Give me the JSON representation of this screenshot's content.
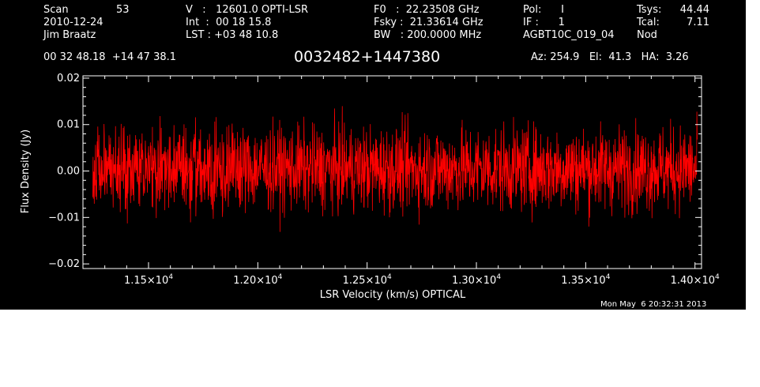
{
  "header": {
    "col1": {
      "l1_label": "Scan",
      "l1_value": "53",
      "l2": "2010-12-24",
      "l3": "Jim Braatz"
    },
    "col2": {
      "l1": "V   :   12601.0 OPTI-LSR",
      "l2": "Int  :  00 18 15.8",
      "l3": "LST : +03 48 10.8"
    },
    "col3": {
      "l1": "F0   :  22.23508 GHz",
      "l2": "Fsky :  21.33614 GHz",
      "l3": "BW   : 200.0000 MHz"
    },
    "col4": {
      "l1": "Pol:      I",
      "l2": "IF :      1",
      "l3": "AGBT10C_019_04"
    },
    "col5": {
      "l1_label": "Tsys:",
      "l1_value": "44.44",
      "l2_label": "Tcal:",
      "l2_value": "7.11",
      "l3": "Nod"
    },
    "coords": "00 32 48.18  +14 47 38.1",
    "source": "0032482+1447380",
    "az_el_ha": "Az: 254.9   El:  41.3   HA:  3.26",
    "timestamp": "Mon May  6 20:32:31 2013"
  },
  "chart_data": {
    "type": "line",
    "title": "0032482+1447380",
    "xlabel": "LSR Velocity (km/s) OPTICAL",
    "ylabel": "Flux Density (Jy)",
    "xlim": [
      11200,
      14030
    ],
    "ylim": [
      -0.021,
      0.0205
    ],
    "yticks": [
      {
        "value": -0.02,
        "label": "−0.02"
      },
      {
        "value": -0.01,
        "label": "−0.01"
      },
      {
        "value": 0.0,
        "label": "0.00"
      },
      {
        "value": 0.01,
        "label": "0.01"
      },
      {
        "value": 0.02,
        "label": "0.02"
      }
    ],
    "xticks": [
      {
        "value": 11500,
        "mantissa": "1.15×10",
        "exp": "4"
      },
      {
        "value": 12000,
        "mantissa": "1.20×10",
        "exp": "4"
      },
      {
        "value": 12500,
        "mantissa": "1.25×10",
        "exp": "4"
      },
      {
        "value": 13000,
        "mantissa": "1.30×10",
        "exp": "4"
      },
      {
        "value": 13500,
        "mantissa": "1.35×10",
        "exp": "4"
      },
      {
        "value": 14000,
        "mantissa": "1.40×10",
        "exp": "4"
      }
    ],
    "series": [
      {
        "color": "#ff0000",
        "x_range": [
          11245,
          14010
        ],
        "mean": 0.0005,
        "rms": 0.0045,
        "min": -0.0135,
        "max": 0.0165,
        "samples": 2048
      }
    ],
    "background": "#000000",
    "axis_color": "#ffffff"
  }
}
